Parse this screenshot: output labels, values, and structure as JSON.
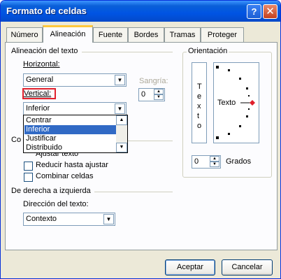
{
  "window": {
    "title": "Formato de celdas",
    "help_glyph": "?",
    "close_glyph": "✕"
  },
  "tabs": [
    "Número",
    "Alineación",
    "Fuente",
    "Bordes",
    "Tramas",
    "Proteger"
  ],
  "alignment": {
    "section_label": "Alineación del texto",
    "horizontal_label": "Horizontal:",
    "horizontal_value": "General",
    "indent_label": "Sangría:",
    "indent_value": "0",
    "vertical_label": "Vertical:",
    "vertical_value": "Inferior",
    "vertical_options": [
      "Centrar",
      "Inferior",
      "Justificar",
      "Distribuido"
    ],
    "vertical_selected": "Inferior"
  },
  "text_control": {
    "section_label": "Co",
    "partial_text": "Ajustar texto",
    "shrink_label": "Reducir hasta ajustar",
    "merge_label": "Combinar celdas"
  },
  "direction": {
    "section_label": "De derecha a izquierda",
    "dir_label": "Dirección del texto:",
    "dir_value": "Contexto"
  },
  "orientation": {
    "section_label": "Orientación",
    "vertical_text": [
      "T",
      "e",
      "x",
      "t",
      "o"
    ],
    "dial_text": "Texto",
    "degrees_value": "0",
    "degrees_label": "Grados"
  },
  "buttons": {
    "accept": "Aceptar",
    "cancel": "Cancelar"
  }
}
